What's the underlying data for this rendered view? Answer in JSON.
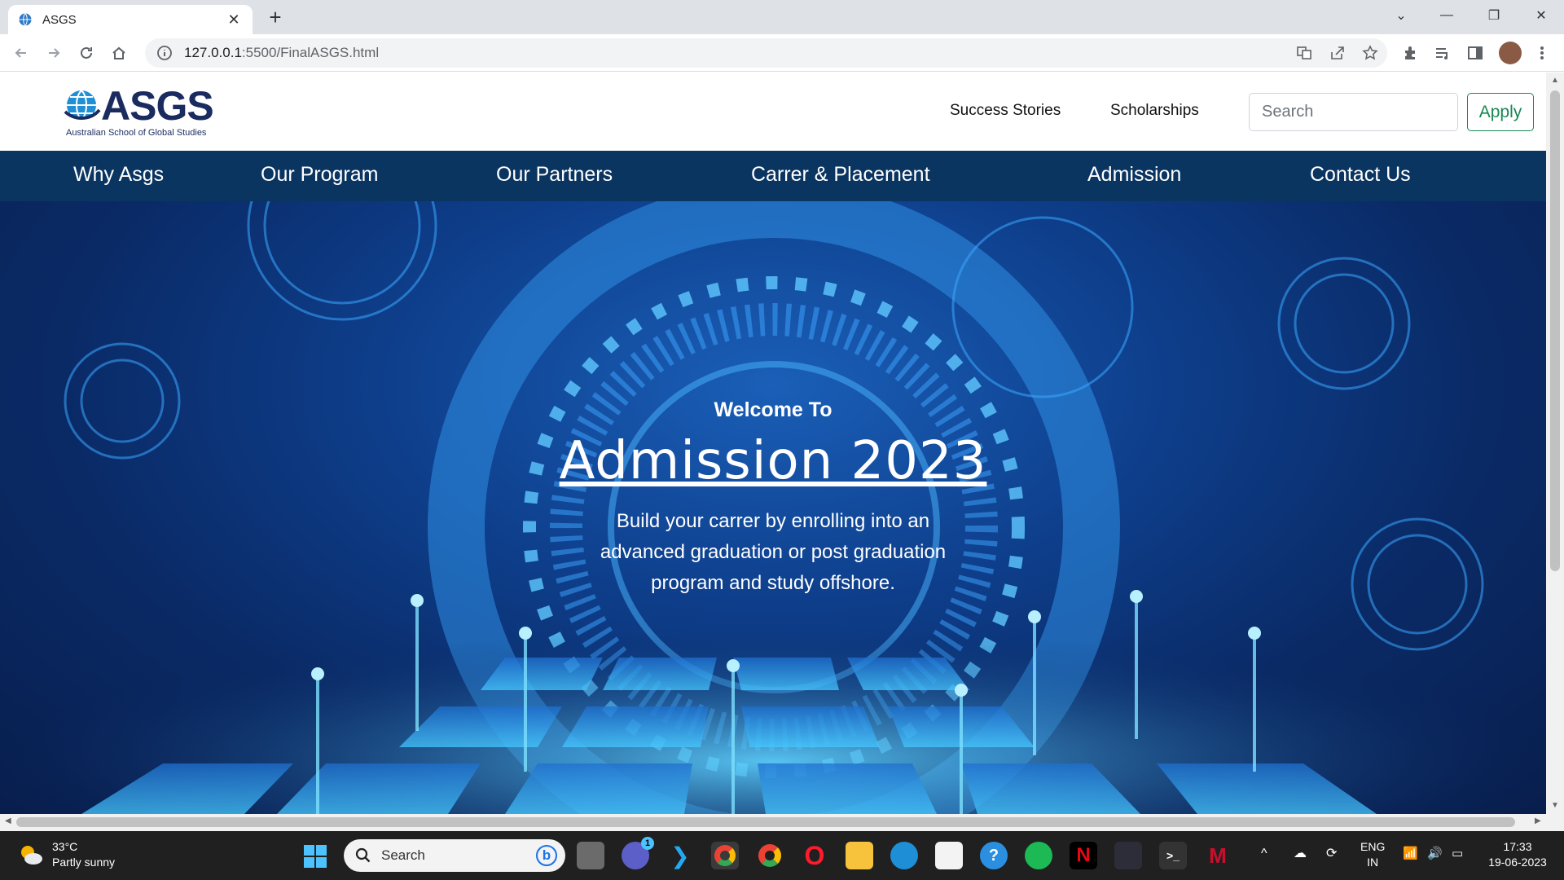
{
  "browser": {
    "tab_title": "ASGS",
    "url_host": "127.0.0.1",
    "url_path": ":5500/FinalASGS.html"
  },
  "site": {
    "logo_text": "ASGS",
    "logo_subtitle": "Australian School of Global Studies",
    "header_links": [
      "Success Stories",
      "Scholarships"
    ],
    "search_placeholder": "Search",
    "apply_label": "Apply",
    "nav": [
      "Why Asgs",
      "Our Program",
      "Our Partners",
      "Carrer & Placement",
      "Admission",
      "Contact Us"
    ],
    "hero": {
      "welcome": "Welcome To",
      "title": "Admission 2023",
      "desc_lines": [
        "Build your carrer by enrolling into an",
        "advanced graduation or post graduation",
        "program and study offshore."
      ]
    },
    "colors": {
      "nav_bg": "#0b3561",
      "apply_green": "#198754",
      "logo_navy": "#1a2b5f"
    }
  },
  "taskbar": {
    "temperature": "33°C",
    "weather": "Partly sunny",
    "search_label": "Search",
    "lang_top": "ENG",
    "lang_bottom": "IN",
    "time": "17:33",
    "date": "19-06-2023",
    "chat_badge": "1"
  }
}
